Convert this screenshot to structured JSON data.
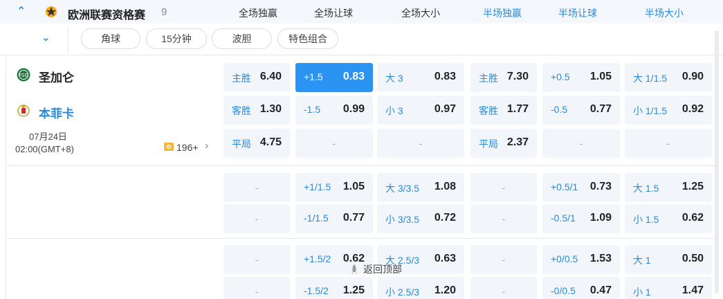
{
  "header": {
    "competition": "欧洲联赛资格赛",
    "count": "9",
    "columns": [
      "全场独赢",
      "全场让球",
      "全场大小",
      "半场独赢",
      "半场让球",
      "半场大小"
    ]
  },
  "filters": [
    "角球",
    "15分钟",
    "波胆",
    "特色组合"
  ],
  "match": {
    "home": "圣加仑",
    "away": "本菲卡",
    "date": "07月24日",
    "time": "02:00(GMT+8)",
    "more": "196+"
  },
  "rows": [
    [
      {
        "label": "主胜",
        "odd": "6.40"
      },
      {
        "label": "+1.5",
        "odd": "0.83",
        "highlight": true
      },
      {
        "label": "大 3",
        "odd": "0.83"
      },
      {
        "label": "主胜",
        "odd": "7.30"
      },
      {
        "label": "+0.5",
        "odd": "1.05"
      },
      {
        "label": "大 1/1.5",
        "odd": "0.90"
      }
    ],
    [
      {
        "label": "客胜",
        "odd": "1.30"
      },
      {
        "label": "-1.5",
        "odd": "0.99"
      },
      {
        "label": "小 3",
        "odd": "0.97"
      },
      {
        "label": "客胜",
        "odd": "1.77"
      },
      {
        "label": "-0.5",
        "odd": "0.77"
      },
      {
        "label": "小 1/1.5",
        "odd": "0.92"
      }
    ],
    [
      {
        "label": "平局",
        "odd": "4.75"
      },
      {
        "dash": "-"
      },
      {
        "dash": "-"
      },
      {
        "label": "平局",
        "odd": "2.37"
      },
      {
        "dash": "-"
      },
      {
        "dash": "-"
      }
    ],
    [
      {
        "dash": "-"
      },
      {
        "label": "+1/1.5",
        "odd": "1.05"
      },
      {
        "label": "大 3/3.5",
        "odd": "1.08"
      },
      {
        "dash": "-"
      },
      {
        "label": "+0.5/1",
        "odd": "0.73"
      },
      {
        "label": "大 1.5",
        "odd": "1.25"
      }
    ],
    [
      {
        "dash": "-"
      },
      {
        "label": "-1/1.5",
        "odd": "0.77"
      },
      {
        "label": "小 3/3.5",
        "odd": "0.72"
      },
      {
        "dash": "-"
      },
      {
        "label": "-0.5/1",
        "odd": "1.09"
      },
      {
        "label": "小 1.5",
        "odd": "0.62"
      }
    ],
    [
      {
        "dash": "-"
      },
      {
        "label": "+1.5/2",
        "odd": "0.62"
      },
      {
        "label": "大 2.5/3",
        "odd": "0.63"
      },
      {
        "dash": "-"
      },
      {
        "label": "+0/0.5",
        "odd": "1.53"
      },
      {
        "label": "大 1",
        "odd": "0.50"
      }
    ],
    [
      {
        "dash": "-"
      },
      {
        "label": "-1.5/2",
        "odd": "1.25"
      },
      {
        "label": "小 2.5/3",
        "odd": "1.20"
      },
      {
        "dash": "-"
      },
      {
        "label": "-0/0.5",
        "odd": "0.47"
      },
      {
        "label": "小 1",
        "odd": "1.47"
      }
    ]
  ],
  "back_to_top": "返回顶部",
  "colors": {
    "accent": "#2a8ad8",
    "highlight": "#2b94f2",
    "cell_bg": "#f2f6fb"
  }
}
